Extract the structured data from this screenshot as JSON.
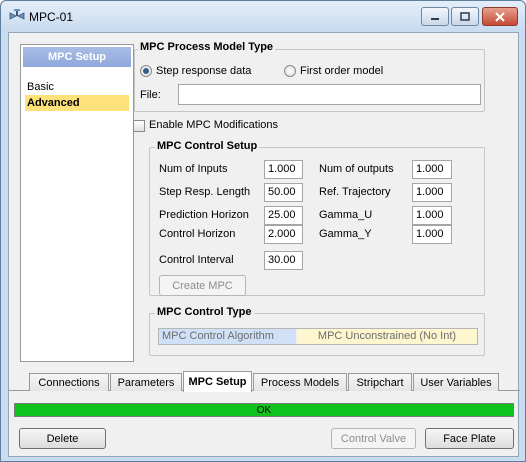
{
  "window": {
    "title": "MPC-01"
  },
  "nav": {
    "header": "MPC Setup",
    "items": [
      {
        "label": "Basic",
        "selected": false
      },
      {
        "label": "Advanced",
        "selected": true
      }
    ]
  },
  "process_model": {
    "title": "MPC Process Model Type",
    "options": [
      {
        "label": "Step response data",
        "selected": true
      },
      {
        "label": "First order model",
        "selected": false
      }
    ],
    "file_label": "File:",
    "file_value": ""
  },
  "enable_mods": {
    "label": "Enable MPC Modifications",
    "checked": false
  },
  "control_setup": {
    "title": "MPC Control Setup",
    "fields": {
      "num_inputs": {
        "label": "Num of Inputs",
        "value": "1.000"
      },
      "num_outputs": {
        "label": "Num of outputs",
        "value": "1.000"
      },
      "step_resp_length": {
        "label": "Step Resp. Length",
        "value": "50.00"
      },
      "ref_trajectory": {
        "label": "Ref. Trajectory",
        "value": "1.000"
      },
      "prediction_horizon": {
        "label": "Prediction Horizon",
        "value": "25.00"
      },
      "gamma_u": {
        "label": "Gamma_U",
        "value": "1.000"
      },
      "control_horizon": {
        "label": "Control Horizon",
        "value": "2.000"
      },
      "gamma_y": {
        "label": "Gamma_Y",
        "value": "1.000"
      },
      "control_interval": {
        "label": "Control Interval",
        "value": "30.00"
      }
    },
    "create_button": "Create MPC"
  },
  "control_type": {
    "title": "MPC Control Type",
    "algorithm_label": "MPC Control Algorithm",
    "algorithm_value": "MPC Unconstrained (No Int)"
  },
  "tabs": [
    {
      "label": "Connections",
      "active": false
    },
    {
      "label": "Parameters",
      "active": false
    },
    {
      "label": "MPC Setup",
      "active": true
    },
    {
      "label": "Process Models",
      "active": false
    },
    {
      "label": "Stripchart",
      "active": false
    },
    {
      "label": "User Variables",
      "active": false
    }
  ],
  "status": {
    "text": "OK",
    "color": "#10c21c"
  },
  "buttons": {
    "delete": "Delete",
    "control_valve": "Control Valve",
    "face_plate": "Face Plate"
  }
}
